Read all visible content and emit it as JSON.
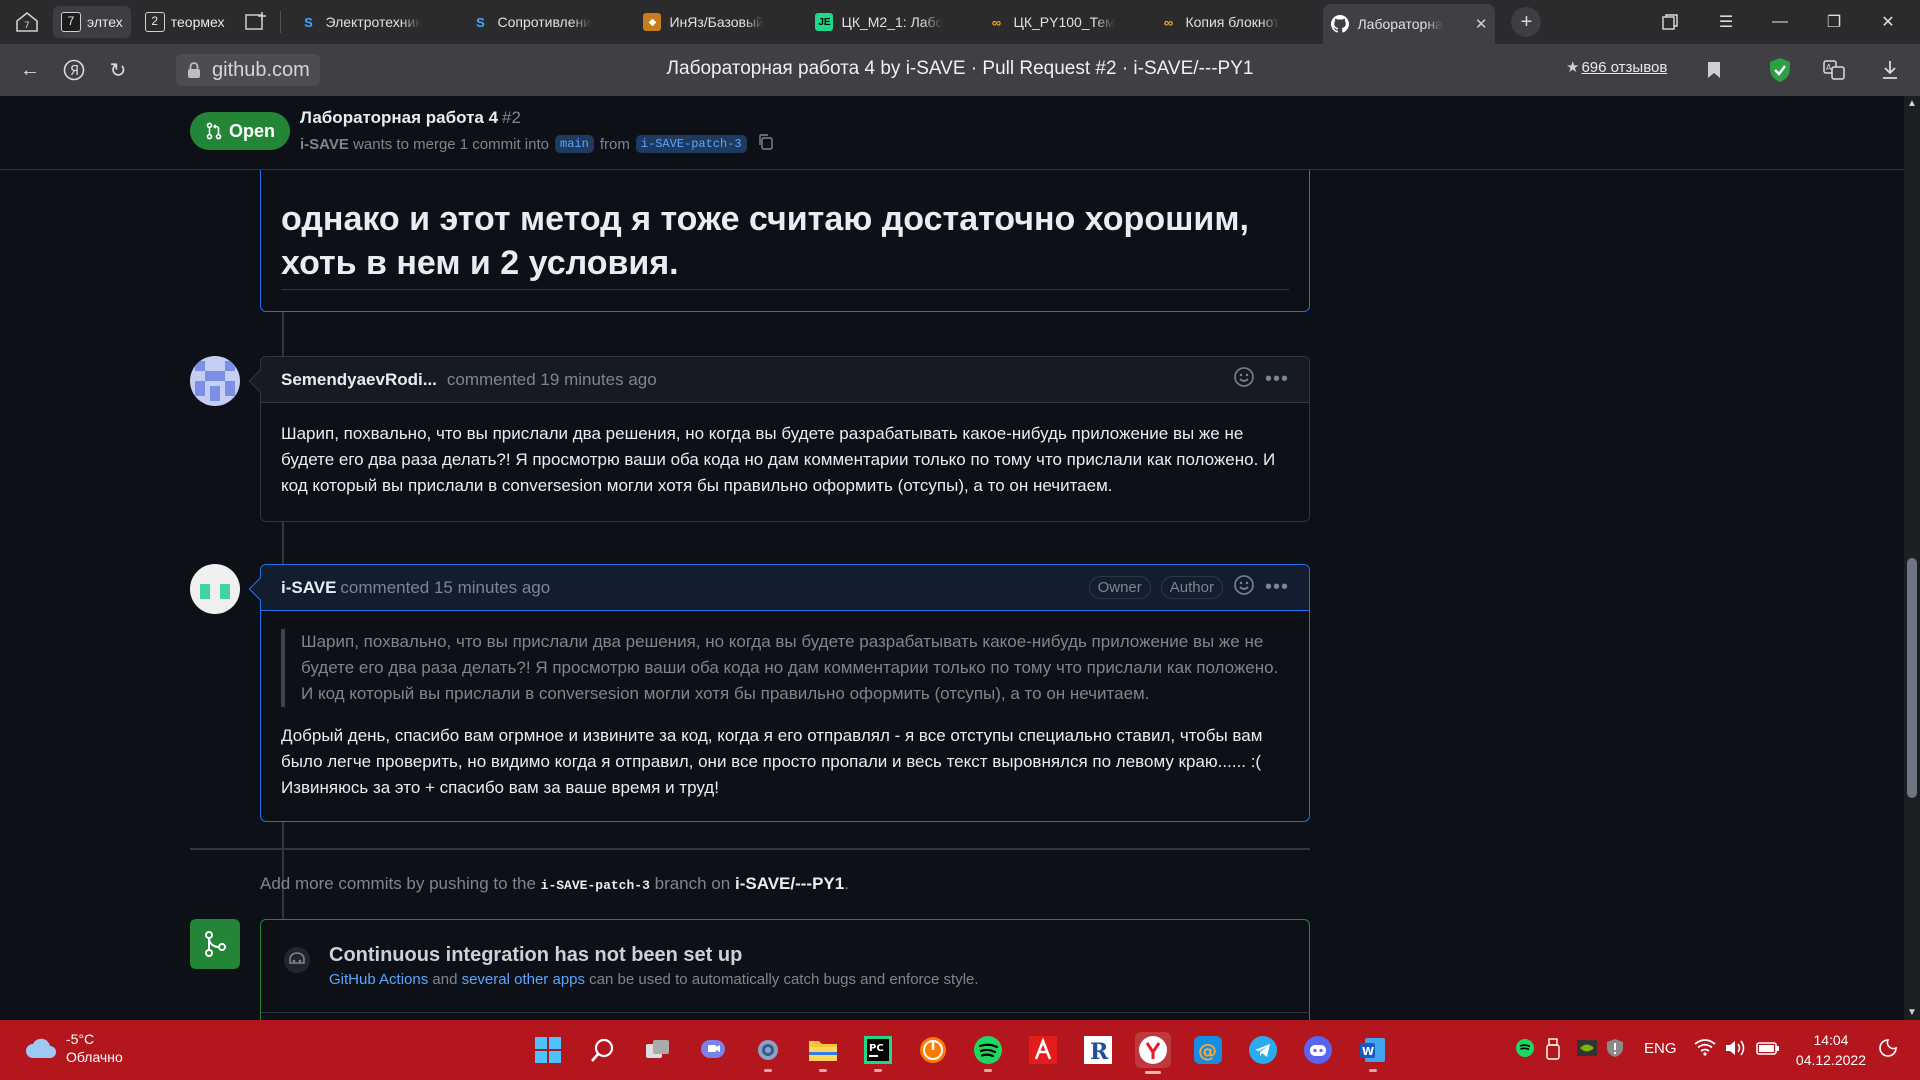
{
  "browser": {
    "groups": [
      {
        "count": "7",
        "label": "элтех",
        "active": true
      },
      {
        "count": "2",
        "label": "теормех",
        "active": false
      }
    ],
    "tabs": [
      {
        "title": "Электротехник",
        "icon": "s-icon",
        "color": "#4aa3ff"
      },
      {
        "title": "Сопротивлени",
        "icon": "s-icon",
        "color": "#4aa3ff"
      },
      {
        "title": "ИнЯз/Базовый",
        "icon": "pattern-icon",
        "color": "#e0a030"
      },
      {
        "title": "ЦК_М2_1: Лабо",
        "icon": "pycharm-edu-icon",
        "color": "#21d789"
      },
      {
        "title": "ЦК_PY100_Тем",
        "icon": "colab-icon",
        "color": "#f9ab00"
      },
      {
        "title": "Копия блокнот",
        "icon": "colab-icon",
        "color": "#f9ab00"
      },
      {
        "title": "Лабораторна",
        "icon": "github-icon",
        "color": "#ffffff",
        "active": true
      }
    ],
    "url": "github.com",
    "page_title": "Лабораторная работа 4 by i-SAVE · Pull Request #2 · i-SAVE/---PY1",
    "reviews": "696 отзывов"
  },
  "pr": {
    "status": "Open",
    "title": "Лабораторная работа 4",
    "number": "#2",
    "author": "i-SAVE",
    "merge_text": "wants to merge 1 commit into",
    "base_branch": "main",
    "from_text": "from",
    "head_branch": "i-SAVE-patch-3"
  },
  "prev_comment": {
    "text_line1": "однако и этот метод я тоже считаю достаточно хорошим,",
    "text_line2": "хоть в нем и 2 условия."
  },
  "comments": [
    {
      "author": "SemendyaevRodi...",
      "meta": "commented 19 minutes ago",
      "body": "Шарип, похвально, что вы прислали два решения, но когда вы будете разрабатывать какое-нибудь приложение вы же не будете его два раза делать?! Я просмотрю ваши оба кода но дам комментарии только по тому что прислали как положено. И код который вы прислали в conversesion могли хотя бы правильно оформить (отсупы), а то он нечитаем."
    },
    {
      "author": "i-SAVE",
      "meta": "commented 15 minutes ago",
      "owner_label": "Owner",
      "author_label": "Author",
      "quote": "Шарип, похвально, что вы прислали два решения, но когда вы будете разрабатывать какое-нибудь приложение вы же не будете его два раза делать?! Я просмотрю ваши оба кода но дам комментарии только по тому что прислали как положено. И код который вы прислали в conversesion могли хотя бы правильно оформить (отсупы), а то он нечитаем.",
      "body": "Добрый день, спасибо вам огрмное и извините за код, когда я его отправлял - я все отступы специально ставил, чтобы вам было легче проверить, но видимо когда я отправил, они все просто пропали и весь текст выровнялся по левому краю...... :( Извиняюсь за это + спасибо вам за ваше время и труд!"
    }
  ],
  "add_more": {
    "prefix": "Add more commits by pushing to the",
    "branch": "i-SAVE-patch-3",
    "middle": "branch on",
    "repo": "i-SAVE/---PY1",
    "suffix": "."
  },
  "ci": {
    "title": "Continuous integration has not been set up",
    "link1": "GitHub Actions",
    "and": "and",
    "link2": "several other apps",
    "rest": "can be used to automatically catch bugs and enforce style."
  },
  "taskbar": {
    "temperature": "-5°C",
    "weather": "Облачно",
    "lang": "ENG",
    "time": "14:04",
    "date": "04.12.2022"
  },
  "colors": {
    "accent_green": "#238636",
    "link_blue": "#58a6ff",
    "taskbar_red": "#b3171d"
  }
}
